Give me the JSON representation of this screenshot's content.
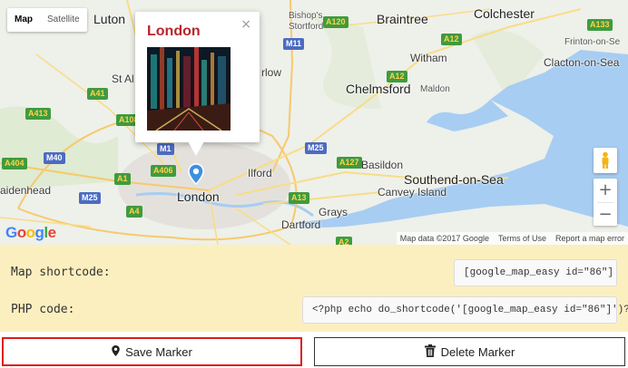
{
  "map": {
    "type_controls": {
      "map_label": "Map",
      "satellite_label": "Satellite"
    },
    "places": {
      "luton": "Luton",
      "st_albans": "St Al",
      "bishops": "Bishop's",
      "stortford": "Stortford",
      "braintree": "Braintree",
      "colchester": "Colchester",
      "frinton": "Frinton-on-Se",
      "witham": "Witham",
      "clacton": "Clacton-on-Sea",
      "harlow": "rlow",
      "chelmsford": "Chelmsford",
      "maldon": "Maldon",
      "basildon": "Basildon",
      "southend": "Southend-on-Sea",
      "canvey": "Canvey Island",
      "ilford": "Ilford",
      "london": "London",
      "aidenhead": "aidenhead",
      "dartford": "Dartford",
      "grays": "Grays"
    },
    "roads": {
      "a120": "A120",
      "a12a": "A12",
      "a12b": "A12",
      "a12c": "A12",
      "a133": "A133",
      "a41": "A41",
      "a413": "A413",
      "a1081": "A1081",
      "a404": "A404",
      "m40": "M40",
      "m1": "M1",
      "a406": "A406",
      "m25a": "M25",
      "m25b": "M25",
      "m11": "M11",
      "a127": "A127",
      "a13": "A13",
      "a4": "A4",
      "a2": "A2",
      "a1": "A1"
    },
    "info_window": {
      "title": "London",
      "close_label": "×"
    },
    "attribution": {
      "data": "Map data ©2017 Google",
      "terms": "Terms of Use",
      "report": "Report a map error"
    },
    "zoom": {
      "in_label": "+",
      "out_label": "−"
    },
    "logo": {
      "text": "Google"
    }
  },
  "shortcodes": {
    "map_label": "Map shortcode:",
    "map_value": "[google_map_easy id=\"86\"]",
    "php_label": "PHP code:",
    "php_value": "<?php echo do_shortcode('[google_map_easy id=\"86\"]')?>"
  },
  "buttons": {
    "save_label": "Save Marker",
    "delete_label": "Delete Marker"
  },
  "colors": {
    "infowindow_title": "#b8252b",
    "panel_bg": "#fcefbf",
    "save_border": "#e01b1b",
    "sea": "#a7cdf2"
  }
}
